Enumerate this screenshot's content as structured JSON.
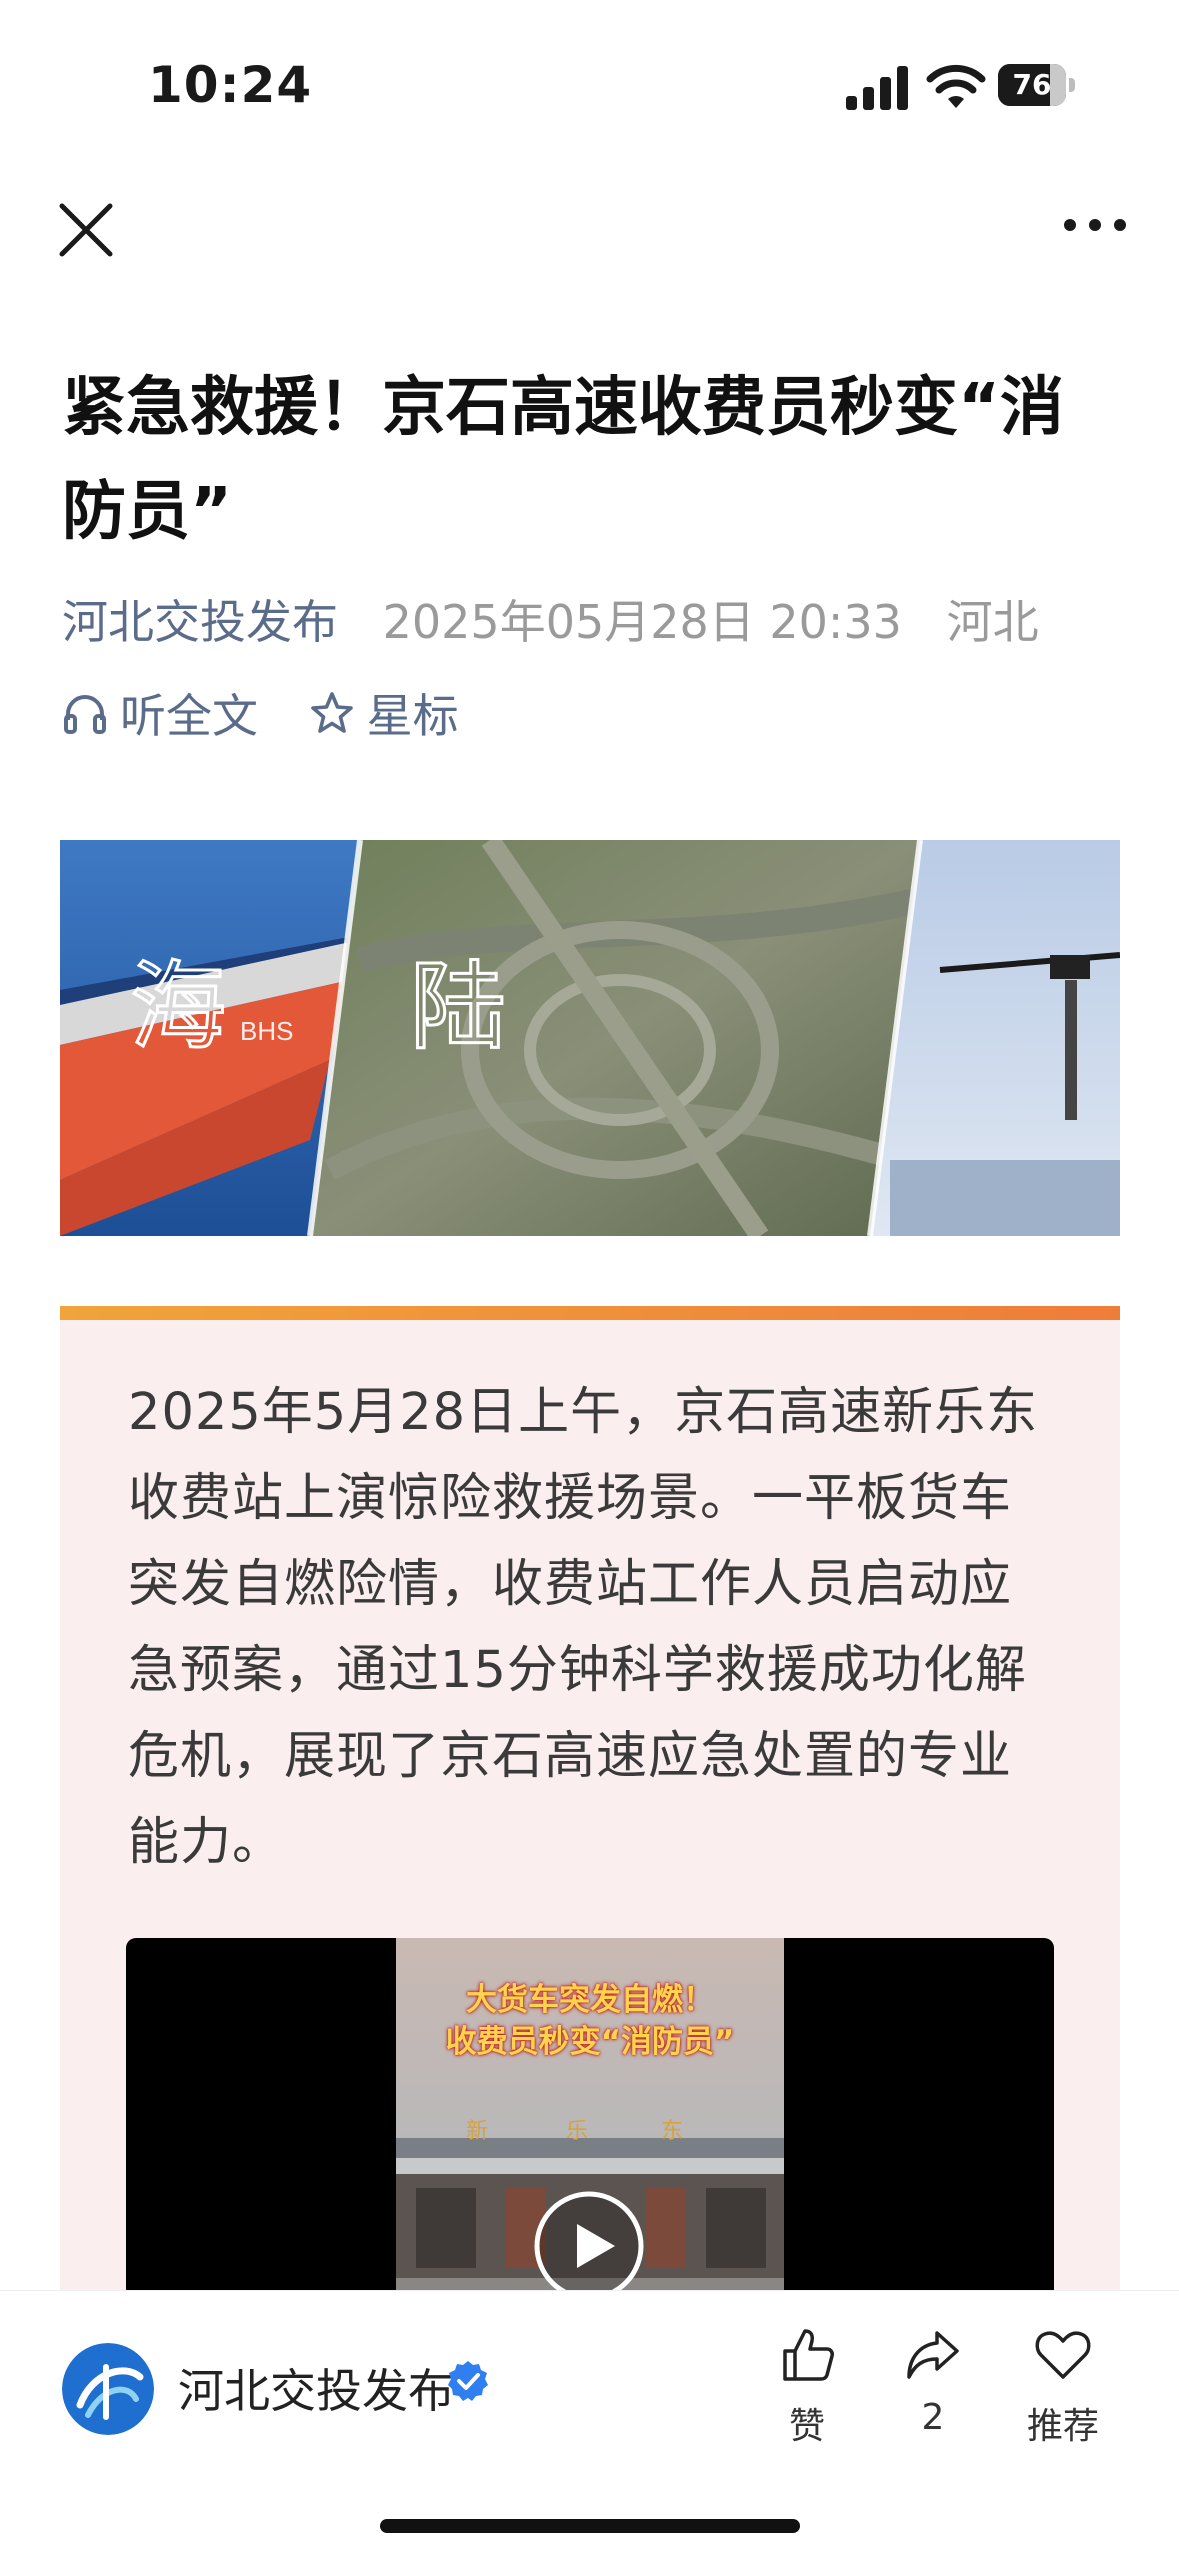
{
  "status_bar": {
    "time": "10:24",
    "battery_level": "76",
    "battery_fraction": 0.76,
    "icons": [
      "cellular-signal-icon",
      "wifi-icon",
      "battery-icon"
    ]
  },
  "nav": {
    "close_icon": "close-icon",
    "more_icon": "more-horizontal-icon"
  },
  "article": {
    "title": "紧急救援！京石高速收费员秒变“消防员”",
    "source": "河北交投发布",
    "date": "2025年05月28日 20:33",
    "region": "河北",
    "listen_label": "听全文",
    "star_label": "星标"
  },
  "hero": {
    "sea_char": "海",
    "land_char": "陆",
    "ship_hull_text": "BHS"
  },
  "summary": {
    "text": "2025年5月28日上午，京石高速新乐东收费站上演惊险救援场景。一平板货车突发自燃险情，收费站工作人员启动应急预案，通过15分钟科学救援成功化解危机，展现了京石高速应急处置的专业能力。"
  },
  "video": {
    "caption_line1": "大货车突发自燃！",
    "caption_line2": "收费员秒变“消防员”"
  },
  "bottom_bar": {
    "account_name": "河北交投发布",
    "like_label": "赞",
    "share_count": "2",
    "recommend_label": "推荐"
  },
  "colors": {
    "accent_orange": "#ee7d3a",
    "summary_bg": "#fbeeee",
    "meta_blue": "#5b6b8a",
    "verified_blue": "#2f7ff0"
  }
}
